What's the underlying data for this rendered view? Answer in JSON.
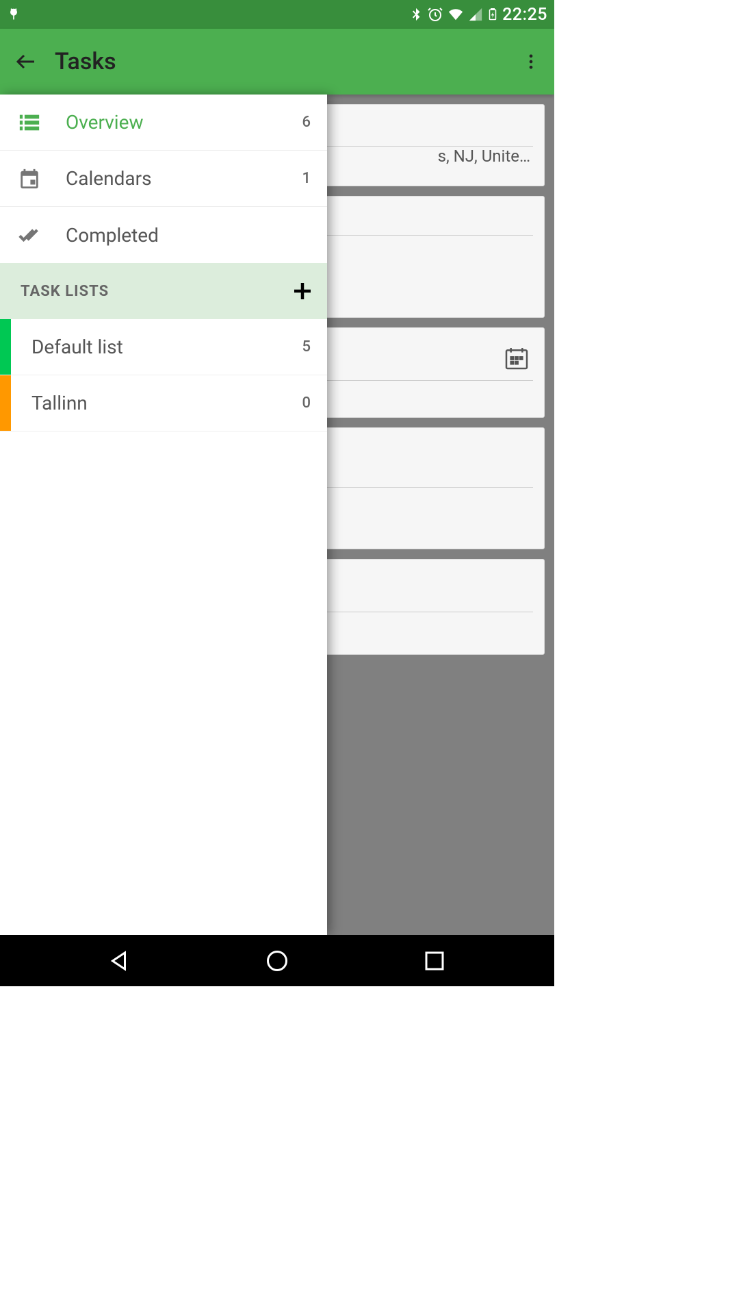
{
  "status": {
    "time": "22:25"
  },
  "header": {
    "title": "Tasks"
  },
  "drawer": {
    "nav": [
      {
        "icon": "overview",
        "label": "Overview",
        "count": "6",
        "active": true
      },
      {
        "icon": "calendar",
        "label": "Calendars",
        "count": "1",
        "active": false
      },
      {
        "icon": "completed",
        "label": "Completed",
        "count": "",
        "active": false
      }
    ],
    "section_title": "TASK LISTS",
    "lists": [
      {
        "label": "Default list",
        "count": "5",
        "color": "#00C853"
      },
      {
        "label": "Tallinn",
        "count": "0",
        "color": "#FF9800"
      }
    ]
  },
  "background": {
    "card1_text": "s, NJ, Unite…"
  }
}
